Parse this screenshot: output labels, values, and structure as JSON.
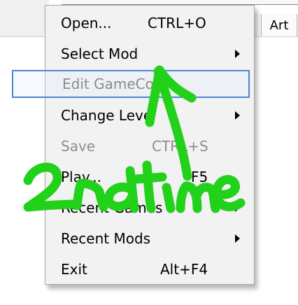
{
  "background": {
    "tab_art": "Art"
  },
  "menu": {
    "items": [
      {
        "label": "Open...",
        "shortcut": "CTRL+O",
        "submenu": false,
        "disabled": false
      },
      {
        "label": "Select Mod",
        "shortcut": "",
        "submenu": true,
        "disabled": false
      },
      {
        "label": "Edit GameCo...",
        "shortcut": "",
        "submenu": false,
        "disabled": true,
        "highlighted": true
      },
      {
        "label": "Change Level",
        "shortcut": "",
        "submenu": true,
        "disabled": false
      },
      {
        "label": "Save",
        "shortcut": "CTRL+S",
        "submenu": false,
        "disabled": true
      },
      {
        "label": "Play...",
        "shortcut": "F5",
        "submenu": false,
        "disabled": false
      },
      {
        "label": "Recent Games",
        "shortcut": "",
        "submenu": true,
        "disabled": false
      },
      {
        "label": "Recent Mods",
        "shortcut": "",
        "submenu": true,
        "disabled": false
      },
      {
        "label": "Exit",
        "shortcut": "Alt+F4",
        "submenu": false,
        "disabled": false
      }
    ]
  },
  "annotation": {
    "text": "2nd time",
    "color": "#22d11a",
    "icon": "hand-drawn-arrow-icon"
  }
}
